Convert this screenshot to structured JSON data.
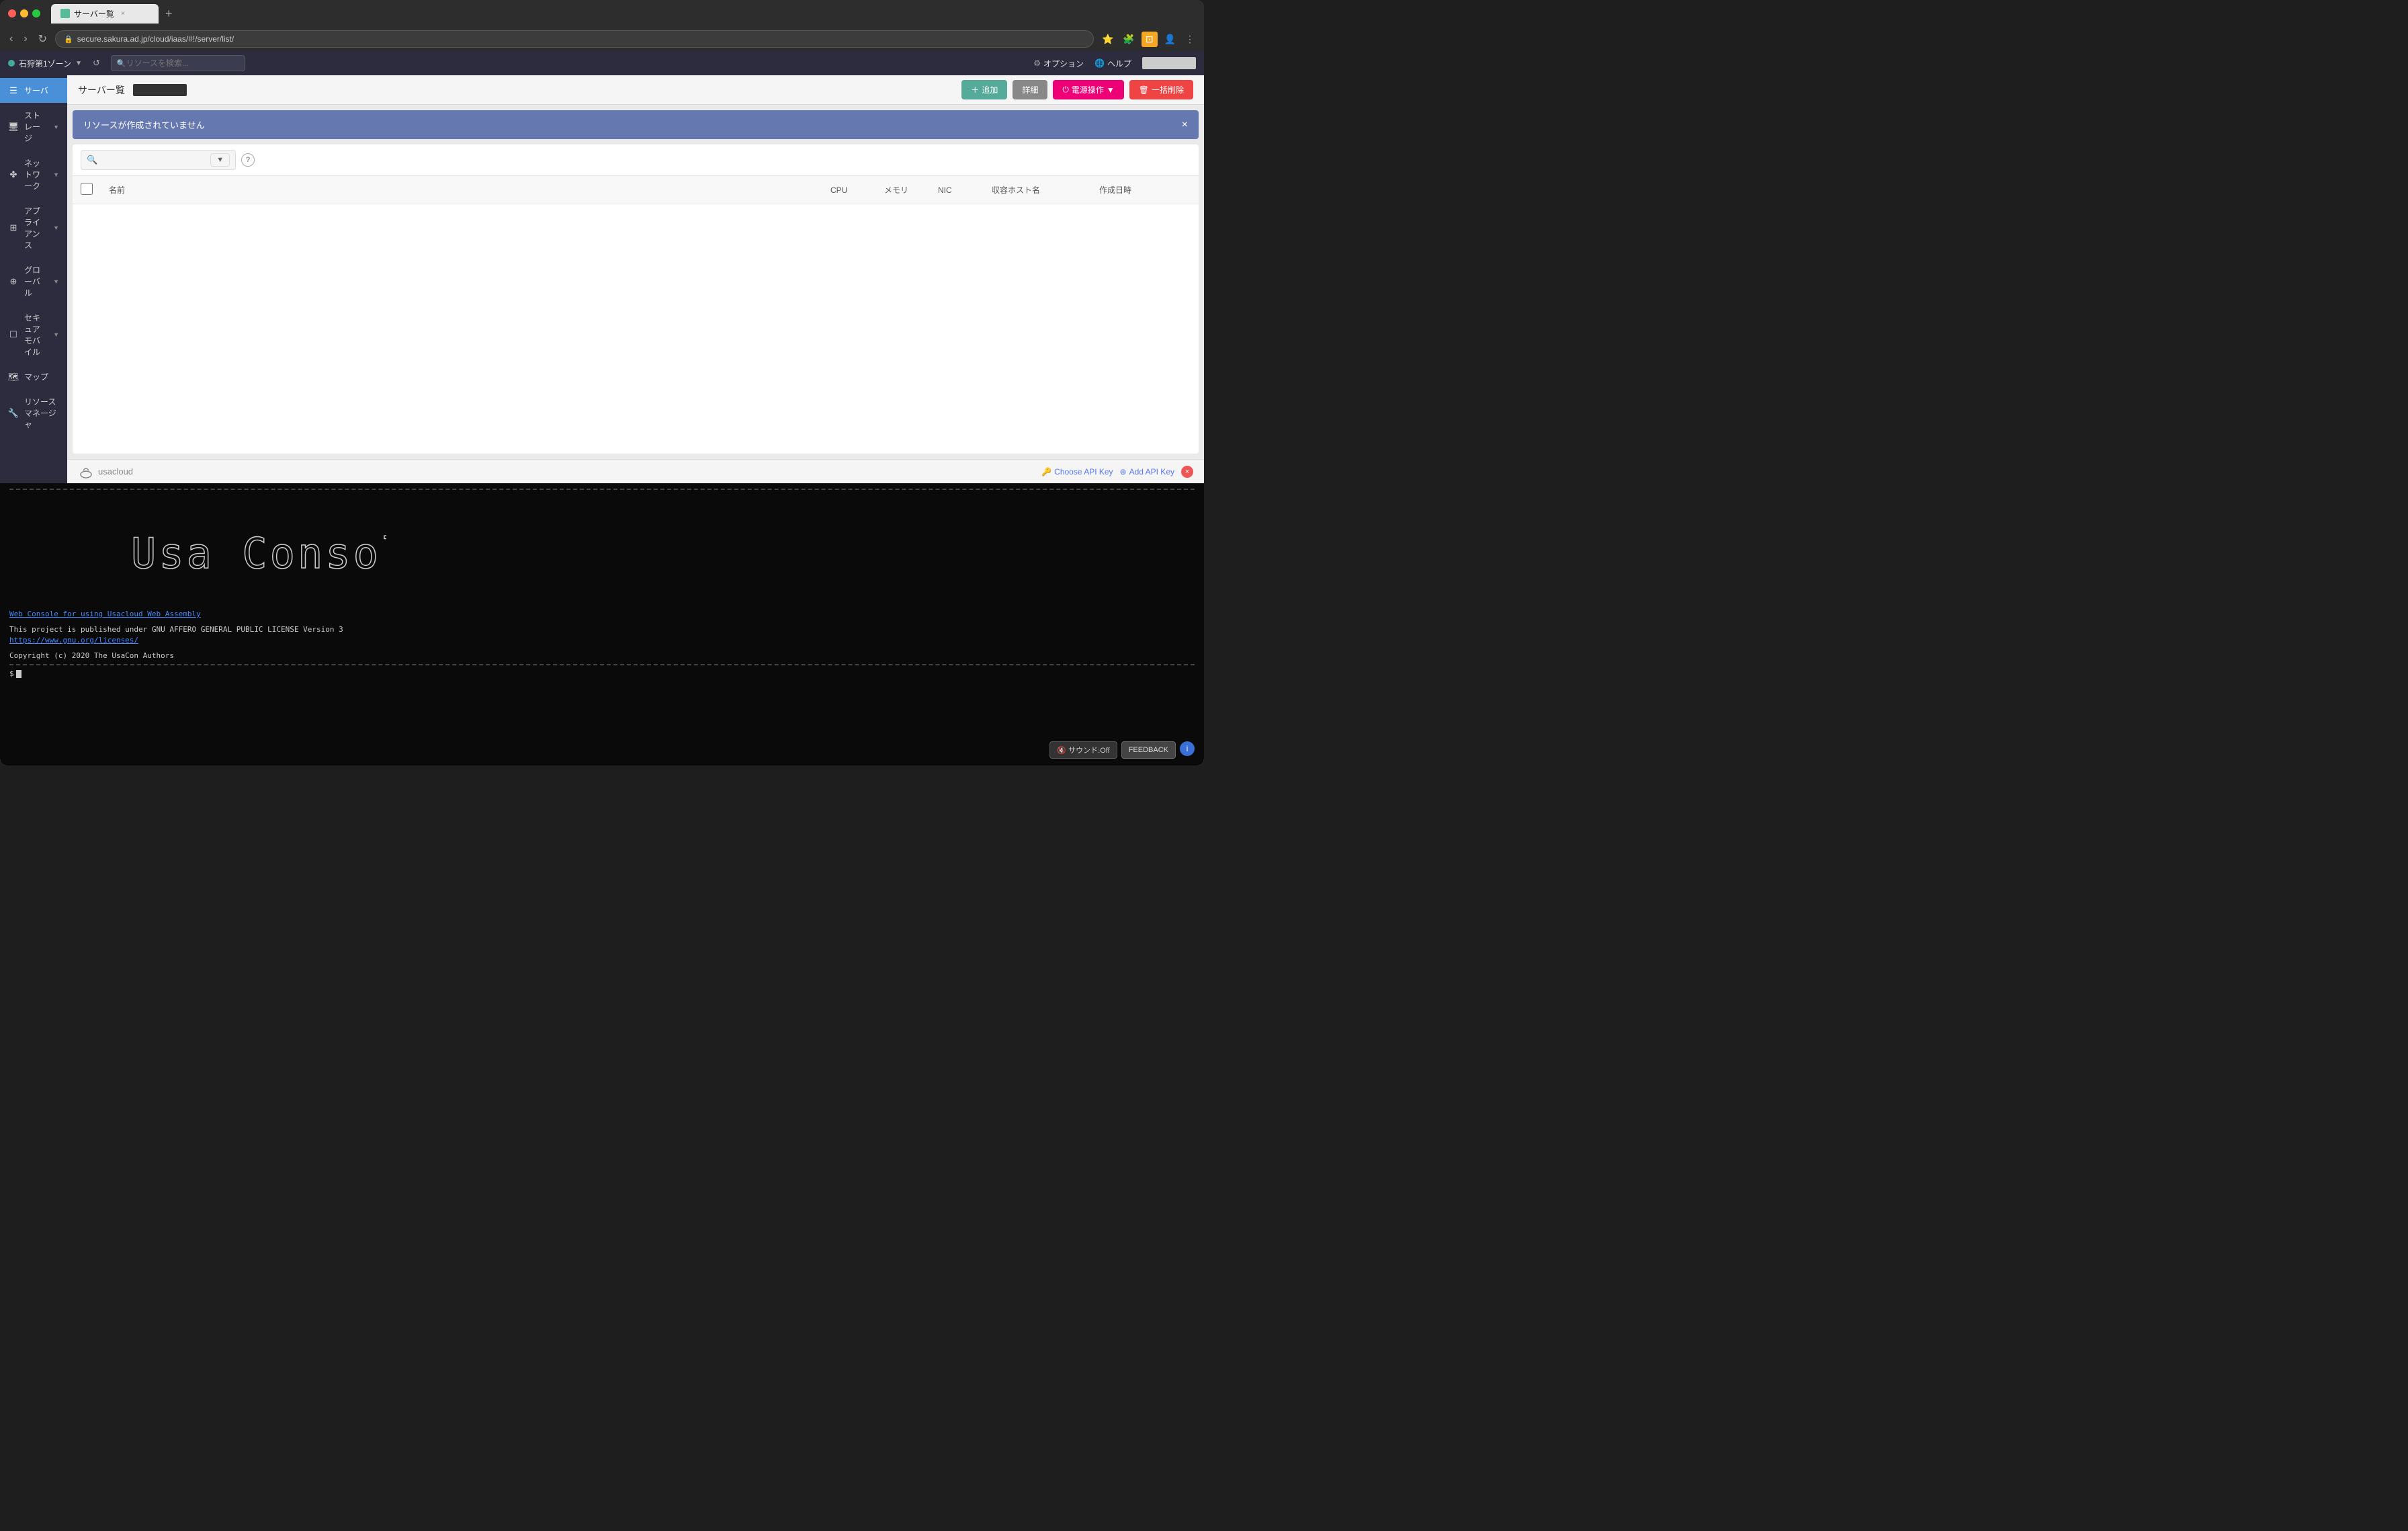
{
  "browser": {
    "tab_label": "サーバー覧",
    "tab_favicon": "green",
    "address": "secure.sakura.ad.jp/cloud/iaas/#!/server/list/",
    "new_tab_label": "+"
  },
  "topbar": {
    "zone_label": "石狩第1ゾーン",
    "search_placeholder": "リソースを検索...",
    "options_label": "オプション",
    "help_label": "ヘルプ",
    "refresh_tooltip": "更新"
  },
  "sidebar": {
    "items": [
      {
        "id": "server",
        "label": "サーバ",
        "icon": "☰",
        "active": true,
        "has_caret": false
      },
      {
        "id": "storage",
        "label": "ストレージ",
        "icon": "🖥",
        "active": false,
        "has_caret": true
      },
      {
        "id": "network",
        "label": "ネットワーク",
        "icon": "✤",
        "active": false,
        "has_caret": true
      },
      {
        "id": "appliance",
        "label": "アプライアンス",
        "icon": "⊞",
        "active": false,
        "has_caret": true
      },
      {
        "id": "global",
        "label": "グローバル",
        "icon": "⊕",
        "active": false,
        "has_caret": true
      },
      {
        "id": "securemobile",
        "label": "セキュアモバイル",
        "icon": "☐",
        "active": false,
        "has_caret": true
      },
      {
        "id": "map",
        "label": "マップ",
        "icon": "🗺",
        "active": false,
        "has_caret": false
      },
      {
        "id": "resource_manager",
        "label": "リソースマネージャ",
        "icon": "🔧",
        "active": false,
        "has_caret": false
      }
    ]
  },
  "content": {
    "page_title": "サーバー覧",
    "actions": {
      "add": "追加",
      "detail": "詳細",
      "power": "電源操作",
      "power_caret": "▼",
      "delete": "一括削除"
    },
    "notice": {
      "text": "リソースが作成されていません",
      "close": "×"
    },
    "table": {
      "columns": [
        "名前",
        "CPU",
        "メモリ",
        "NIC",
        "収容ホスト名",
        "作成日時"
      ],
      "rows": []
    },
    "search_placeholder": ""
  },
  "footer": {
    "logo_text": "usacloud",
    "choose_api_key": "Choose API Key",
    "add_api_key": "Add API Key"
  },
  "terminal": {
    "divider": "================================================================================",
    "logo_art": "  _   _          ___                      _      \n | | | |___  __ _ / __| ___  _ _  ___  ___ | | ___ \n | |_| |(_-</ _` |\\__ \\/ _ \\| ' \\(_-< / _ \\| |/ -_)\n  \\___/ /__/\\__,_||___/\\___/|_||_|/__/ \\___/|_|\\___|",
    "web_console_link": "Web Console for using Usacloud Web Assembly",
    "license_text": "This project is published under GNU AFFERO GENERAL PUBLIC LICENSE Version 3",
    "license_url": "https://www.gnu.org/licenses/",
    "copyright": "Copyright (c) 2020 The UsaCon Authors",
    "prompt": "$",
    "sound_label": "🔇 サウンド:Off",
    "feedback_label": "FEEDBACK",
    "info_label": "i"
  }
}
